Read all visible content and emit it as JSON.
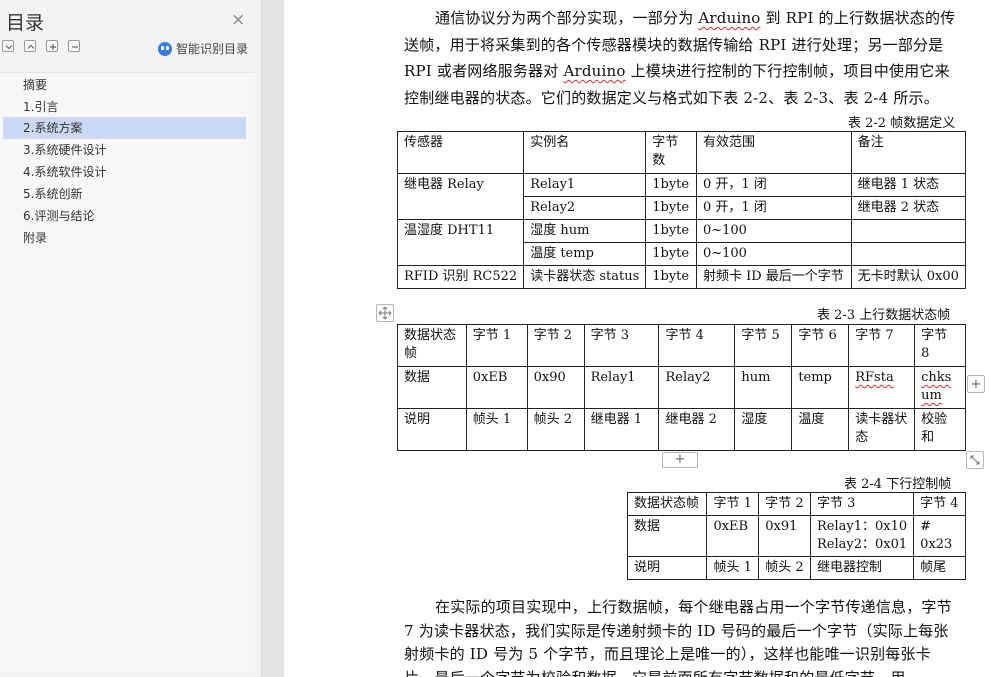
{
  "sidebar": {
    "title": "目录",
    "smart_toc": "智能识别目录",
    "items": [
      {
        "label": "摘要"
      },
      {
        "label": "1.引言"
      },
      {
        "label": "2.系统方案"
      },
      {
        "label": "3.系统硬件设计"
      },
      {
        "label": "4.系统软件设计"
      },
      {
        "label": "5.系统创新"
      },
      {
        "label": "6.评测与结论"
      },
      {
        "label": "附录"
      }
    ]
  },
  "doc": {
    "para1": {
      "a": "通信协议分为两个部分实现，一部分为 ",
      "w1": "Arduino",
      "b": " 到 RPI 的上行数据状态的传送帧，用于将采集到的各个传感器模块的数据传输给 RPI 进行处理；另一部分是 RPI 或者网络服务器对 ",
      "w2": "Arduino",
      "c": " 上模块进行控制的下行控制帧，项目中使用它来控制继电器的状态。它们的数据定义与格式如下表 2-2、表 2-3、表 2-4 所示。"
    },
    "table1": {
      "caption": "表 2-2 帧数据定义",
      "headers": [
        "传感器",
        "实例名",
        "字节数",
        "有效范围",
        "备注"
      ],
      "rows": [
        [
          "继电器 Relay",
          "Relay1",
          "1byte",
          "0 开，1 闭",
          "继电器 1 状态"
        ],
        [
          "",
          "Relay2",
          "1byte",
          "0 开，1 闭",
          "继电器 2 状态"
        ],
        [
          "温湿度 DHT11",
          "湿度 hum",
          "1byte",
          "0~100",
          ""
        ],
        [
          "",
          "温度 temp",
          "1byte",
          "0~100",
          ""
        ],
        [
          "RFID 识别 RC522",
          "读卡器状态 status",
          "1byte",
          "射频卡 ID 最后一个字节",
          "无卡时默认 0x00"
        ]
      ]
    },
    "table2": {
      "caption": "表 2-3  上行数据状态帧",
      "headers": [
        "数据状态帧",
        "字节 1",
        "字节 2",
        "字节 3",
        "字节 4",
        "字节 5",
        "字节 6",
        "字节 7",
        "字节 8"
      ],
      "rows": [
        [
          "数据",
          "0xEB",
          "0x90",
          "Relay1",
          "Relay2",
          "hum",
          "temp",
          "RFsta",
          "chksum"
        ],
        [
          "说明",
          "帧头 1",
          "帧头 2",
          "继电器 1",
          "继电器 2",
          "湿度",
          "温度",
          "读卡器状态",
          "校验和"
        ]
      ]
    },
    "table3": {
      "caption": "表 2-4  下行控制帧",
      "headers": [
        "数据状态帧",
        "字节 1",
        "字节 2",
        "字节 3",
        "字节 4"
      ],
      "data_row": [
        "数据",
        "0xEB",
        "0x91",
        "Relay1：0x10",
        "#"
      ],
      "data_row2": [
        "Relay2：0x01",
        "0x23"
      ],
      "desc_row": [
        "说明",
        "帧头 1",
        "帧头 2",
        "继电器控制",
        "帧尾"
      ]
    },
    "para2": "在实际的项目实现中，上行数据帧，每个继电器占用一个字节传递信息，字节 7 为读卡器状态，我们实际是传递射频卡的 ID 号码的最后一个字节（实际上每张射频卡的 ID 号为 5 个字节，而且理论上是唯一的），这样也能唯一识别每张卡片，最后一个字节为校验和数据，它是前面所有字节数据和的最低字节。用"
  },
  "ui": {
    "plus": "+",
    "close": "×"
  }
}
